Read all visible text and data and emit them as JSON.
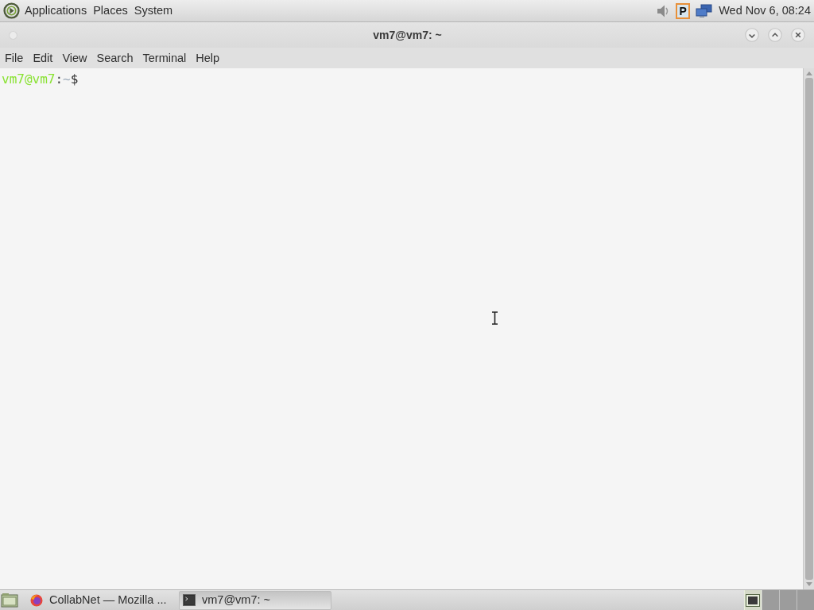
{
  "top_panel": {
    "menus": [
      "Applications",
      "Places",
      "System"
    ],
    "tray": [
      {
        "kind": "volume"
      },
      {
        "kind": "letter",
        "label": "P"
      },
      {
        "kind": "network"
      }
    ],
    "clock": "Wed Nov 6, 08:24"
  },
  "window": {
    "title": "vm7@vm7: ~",
    "controls": [
      {
        "kind": "minimize"
      },
      {
        "kind": "maximize"
      },
      {
        "kind": "close"
      }
    ],
    "menu": [
      "File",
      "Edit",
      "View",
      "Search",
      "Terminal",
      "Help"
    ]
  },
  "terminal": {
    "prompt": {
      "user_host": "vm7@vm7",
      "separator": ":",
      "path": "~",
      "symbol": "$"
    }
  },
  "taskbar": {
    "tasks": [
      {
        "kind": "browser",
        "label": "CollabNet — Mozilla ...",
        "selected": false
      },
      {
        "kind": "terminal",
        "label": "vm7@vm7: ~",
        "selected": true
      }
    ],
    "workspaces": [
      {
        "selected": true
      },
      {
        "selected": false
      },
      {
        "selected": false
      },
      {
        "selected": false
      }
    ]
  }
}
